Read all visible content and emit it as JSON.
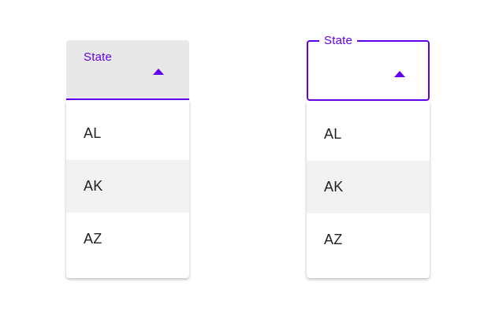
{
  "colors": {
    "accent": "#6200ee",
    "filled_background": "#e8e8e8",
    "hover_background": "#f2f2f2",
    "text": "#212121"
  },
  "filled_select": {
    "label": "State",
    "icon": "caret-up-icon",
    "options": [
      {
        "label": "AL",
        "hovered": false
      },
      {
        "label": "AK",
        "hovered": true
      },
      {
        "label": "AZ",
        "hovered": false
      }
    ]
  },
  "outlined_select": {
    "label": "State",
    "icon": "caret-up-icon",
    "options": [
      {
        "label": "AL",
        "hovered": false
      },
      {
        "label": "AK",
        "hovered": true
      },
      {
        "label": "AZ",
        "hovered": false
      }
    ]
  }
}
